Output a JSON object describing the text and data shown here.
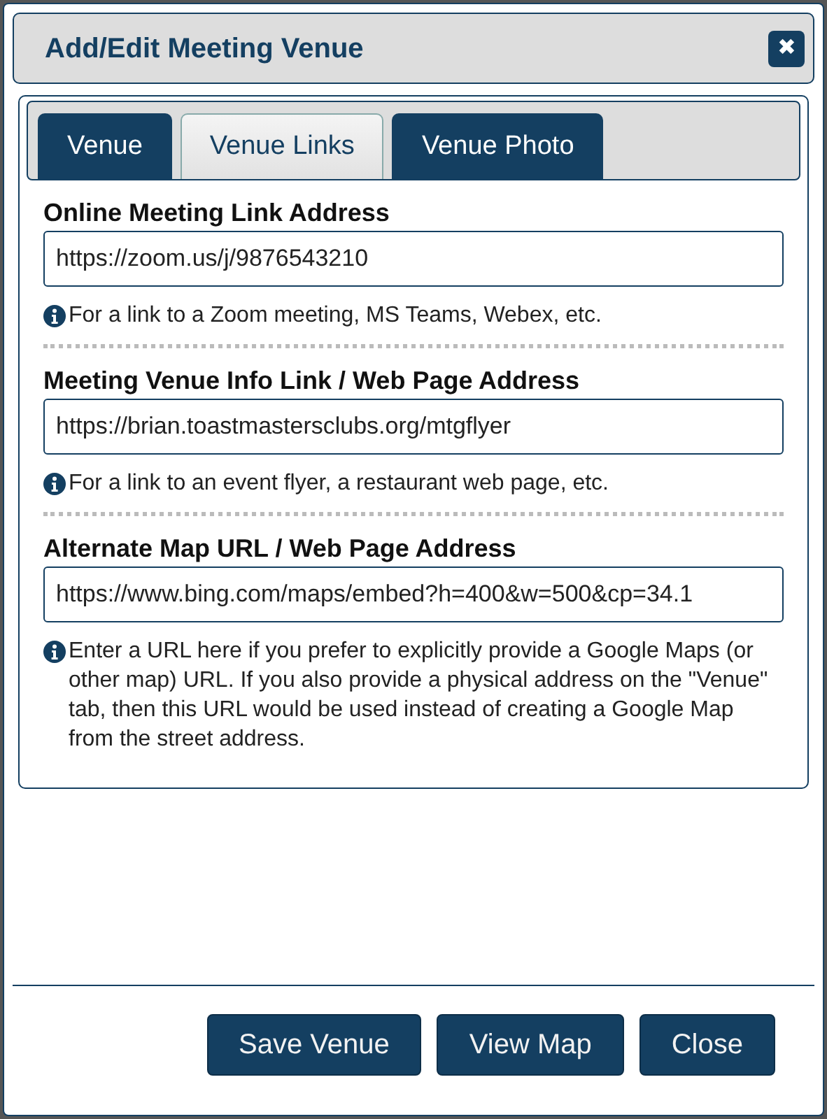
{
  "dialog": {
    "title": "Add/Edit Meeting Venue",
    "close": "✖"
  },
  "tabs": [
    {
      "label": "Venue",
      "selected": false
    },
    {
      "label": "Venue Links",
      "selected": true
    },
    {
      "label": "Venue Photo",
      "selected": false
    }
  ],
  "fields": [
    {
      "label": "Online Meeting Link Address",
      "value": "https://zoom.us/j/9876543210",
      "help": "For a link to a Zoom meeting, MS Teams, Webex, etc."
    },
    {
      "label": "Meeting Venue Info Link / Web Page Address",
      "value": "https://brian.toastmastersclubs.org/mtgflyer",
      "help": "For a link to an event flyer, a restaurant web page, etc."
    },
    {
      "label": "Alternate Map URL / Web Page Address",
      "value": "https://www.bing.com/maps/embed?h=400&w=500&cp=34.1",
      "help": "Enter a URL here if you prefer to explicitly provide a Google Maps (or other map) URL. If you also provide a physical address on the \"Venue\" tab, then this URL would be used instead of creating a Google Map from the street address."
    }
  ],
  "buttons": [
    "Save Venue",
    "View Map",
    "Close"
  ]
}
